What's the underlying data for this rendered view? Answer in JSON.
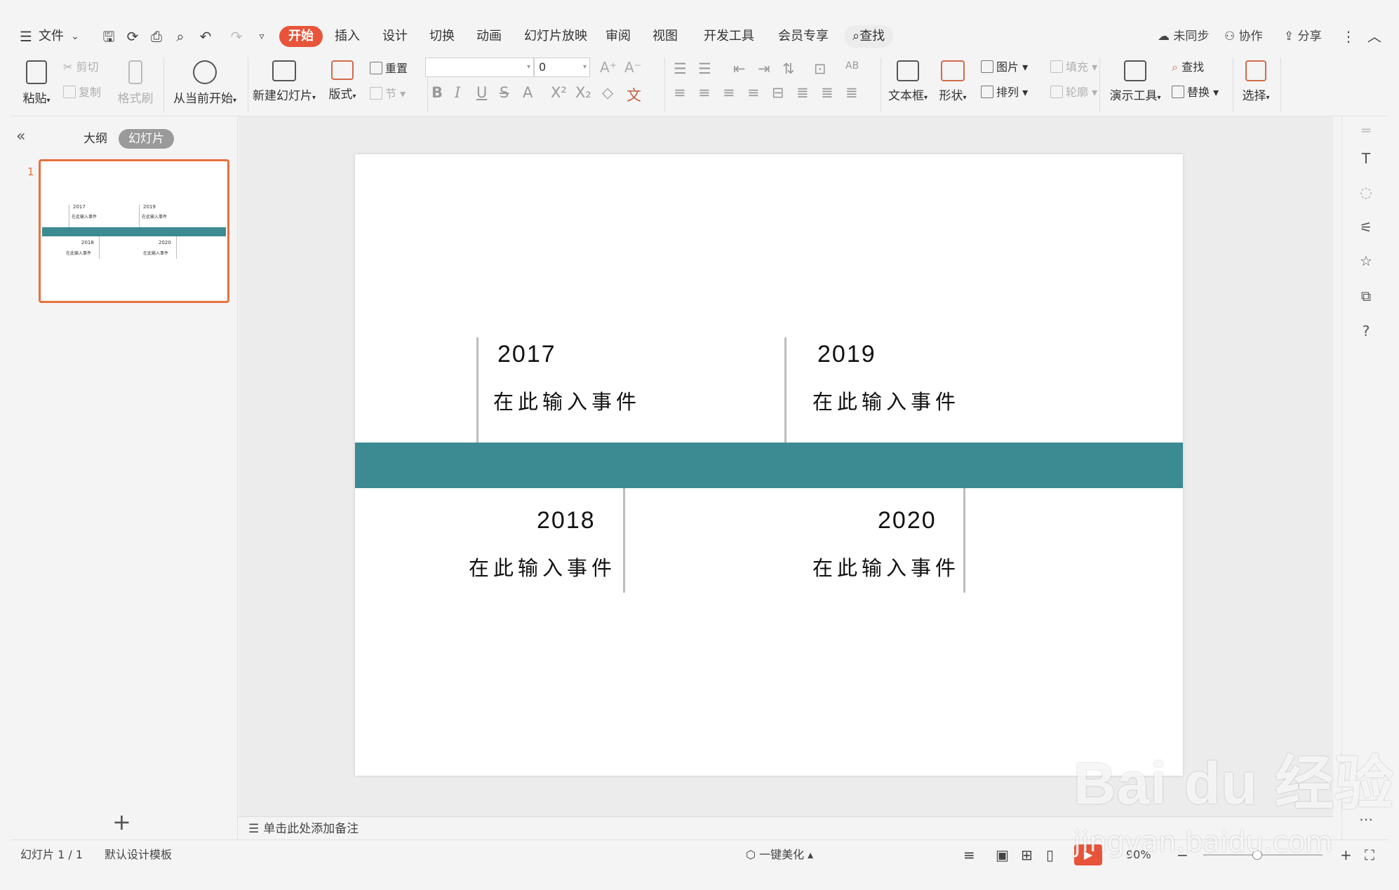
{
  "menubar": {
    "file_label": "文件",
    "tabs": [
      "开始",
      "插入",
      "设计",
      "切换",
      "动画",
      "幻灯片放映",
      "审阅",
      "视图",
      "开发工具",
      "会员专享"
    ],
    "search_label": "查找",
    "sync_label": "未同步",
    "collab_label": "协作",
    "share_label": "分享"
  },
  "ribbon": {
    "paste": "粘贴",
    "cut": "剪切",
    "copy": "复制",
    "format_painter": "格式刷",
    "play_from_current": "从当前开始",
    "new_slide": "新建幻灯片",
    "layout": "版式",
    "reset": "重置",
    "section": "节",
    "font_size": "0",
    "textbox": "文本框",
    "shape": "形状",
    "picture": "图片",
    "fill": "填充",
    "arrange": "排列",
    "outline": "轮廓",
    "present_tools": "演示工具",
    "find": "查找",
    "replace": "替换",
    "select": "选择"
  },
  "leftpanel": {
    "outline_tab": "大纲",
    "slides_tab": "幻灯片",
    "slide_number": "1",
    "add_button": "+"
  },
  "slide": {
    "band_color": "#3c8a92",
    "events": [
      {
        "year": "2017",
        "text": "在此输入事件"
      },
      {
        "year": "2019",
        "text": "在此输入事件"
      },
      {
        "year": "2018",
        "text": "在此输入事件"
      },
      {
        "year": "2020",
        "text": "在此输入事件"
      }
    ]
  },
  "notes": {
    "placeholder": "单击此处添加备注"
  },
  "statusbar": {
    "slide_count": "幻灯片 1 / 1",
    "template": "默认设计模板",
    "beautify": "一键美化",
    "zoom": "90%"
  },
  "watermark": {
    "brand": "Bai  du 经验",
    "url": "jingyan.baidu.com"
  },
  "colors": {
    "accent": "#e8543a",
    "thumb_border": "#e8703e",
    "timeline": "#3c8a92"
  }
}
